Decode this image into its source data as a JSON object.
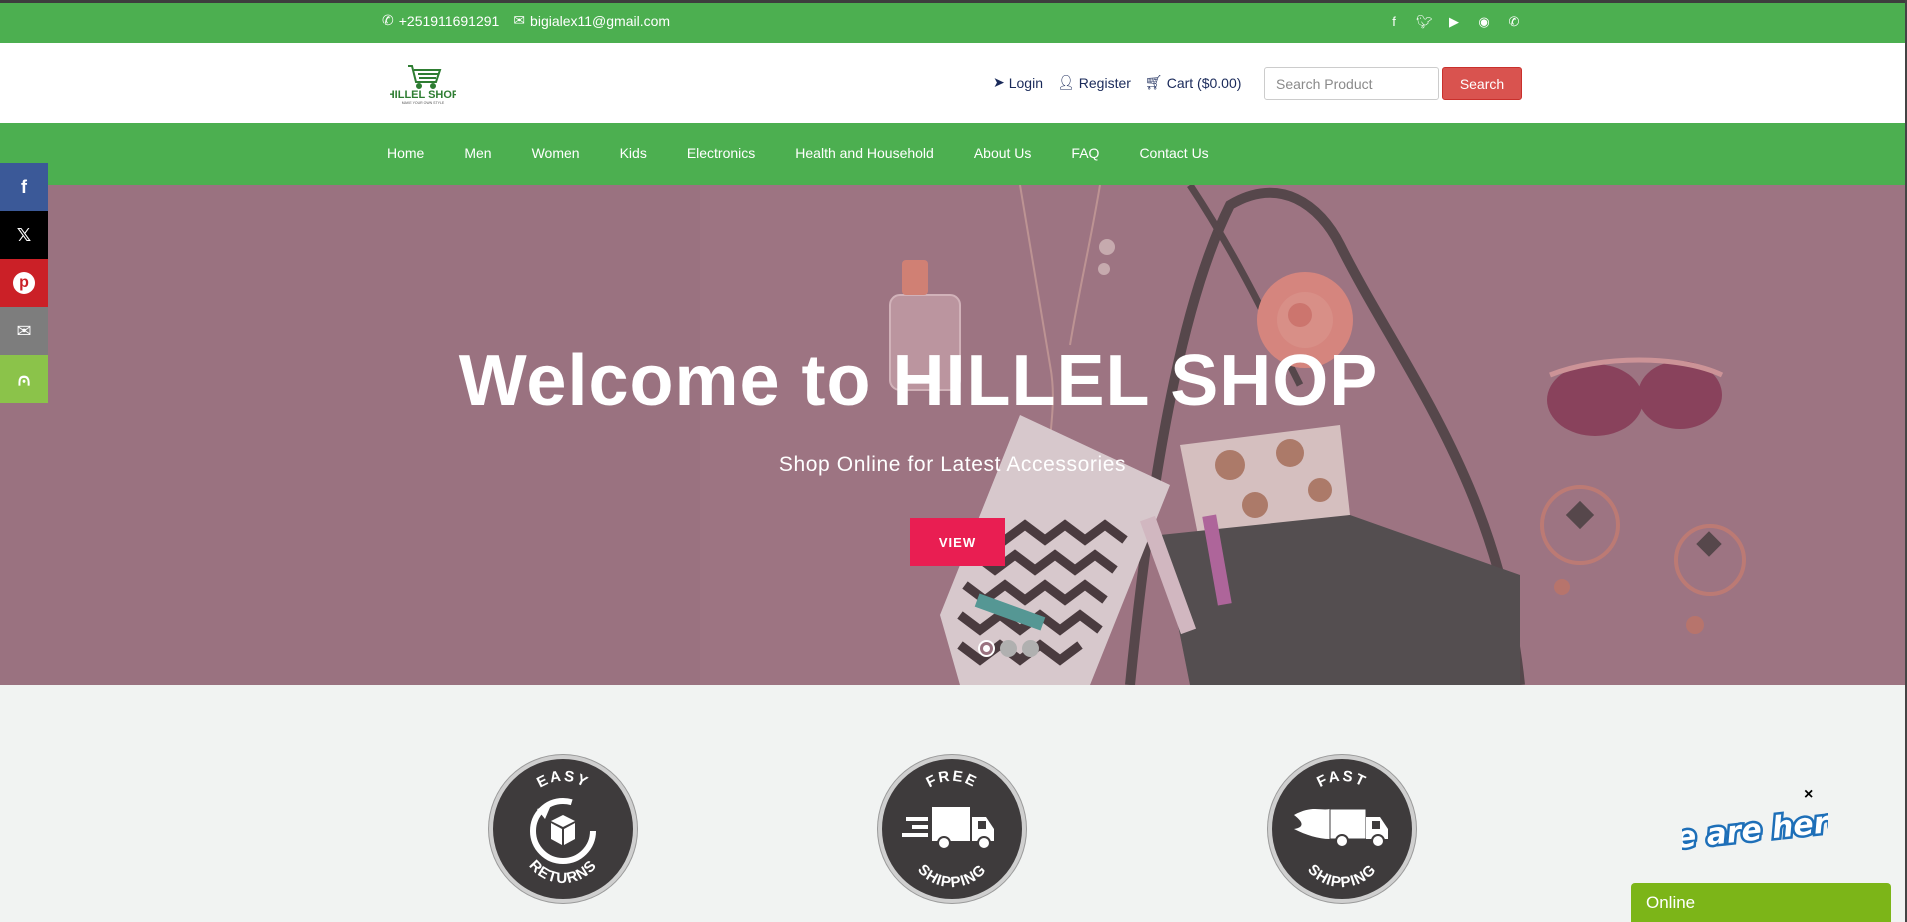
{
  "topbar": {
    "phone": "+251911691291",
    "email": "bigialex11@gmail.com",
    "social_icons": [
      "facebook-icon",
      "twitter-icon",
      "youtube-icon",
      "instagram-icon",
      "whatsapp-icon"
    ]
  },
  "header": {
    "logo_text": "HILLEL SHOP",
    "logo_tagline": "MAKE YOUR OWN STYLE",
    "login_label": "Login",
    "register_label": "Register",
    "cart_label": "Cart ($0.00)",
    "search_placeholder": "Search Product",
    "search_button": "Search"
  },
  "nav": {
    "items": [
      "Home",
      "Men",
      "Women",
      "Kids",
      "Electronics",
      "Health and Household",
      "About Us",
      "FAQ",
      "Contact Us"
    ]
  },
  "hero": {
    "title": "Welcome to HILLEL SHOP",
    "subtitle": "Shop Online for Latest Accessories",
    "button": "VIEW",
    "slides": 3,
    "active_slide": 1
  },
  "share": [
    "facebook-icon",
    "x-icon",
    "pinterest-icon",
    "email-icon",
    "share-icon"
  ],
  "features": [
    {
      "top": "EASY",
      "bottom": "RETURNS"
    },
    {
      "top": "FREE",
      "bottom": "SHIPPING"
    },
    {
      "top": "FAST",
      "bottom": "SHIPPING"
    }
  ],
  "chat": {
    "banner": "We are here!",
    "status": "Online",
    "close": "×"
  },
  "colors": {
    "green": "#4caf50",
    "search_red": "#d9534f",
    "hero_button": "#e91e52",
    "chat_green": "#7cb518"
  }
}
